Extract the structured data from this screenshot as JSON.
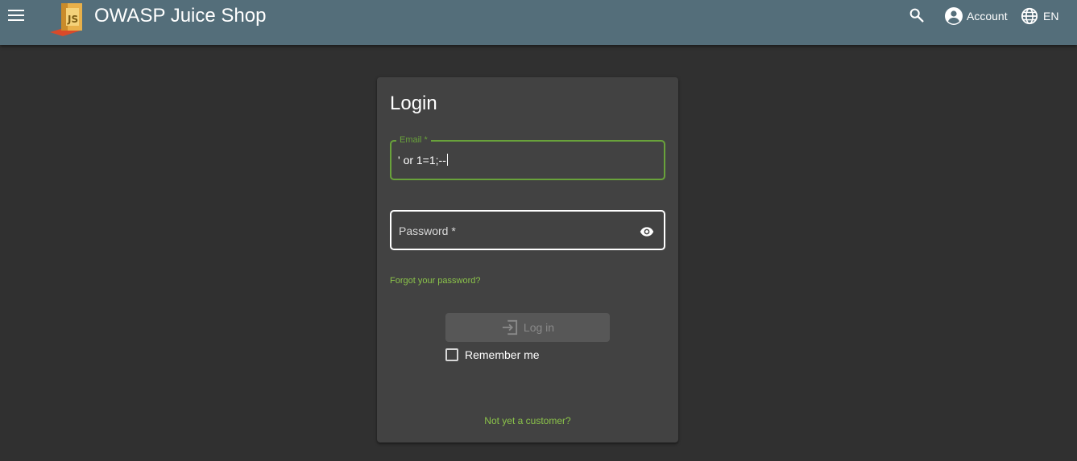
{
  "header": {
    "app_title": "OWASP Juice Shop",
    "account_label": "Account",
    "language_label": "EN",
    "menu_icon": "menu-icon",
    "search_icon": "search-icon",
    "account_icon": "account-circle-icon",
    "language_icon": "globe-icon"
  },
  "login": {
    "title": "Login",
    "email_label": "Email *",
    "email_value": "' or 1=1;--",
    "password_placeholder": "Password *",
    "forgot_password": "Forgot your password?",
    "login_button": "Log in",
    "remember_me": "Remember me",
    "remember_checked": false,
    "register_link": "Not yet a customer?"
  },
  "colors": {
    "toolbar": "#546e7a",
    "background": "#303030",
    "card": "#424242",
    "accent_green": "#8bc34a",
    "focus_green": "#69a23b"
  }
}
